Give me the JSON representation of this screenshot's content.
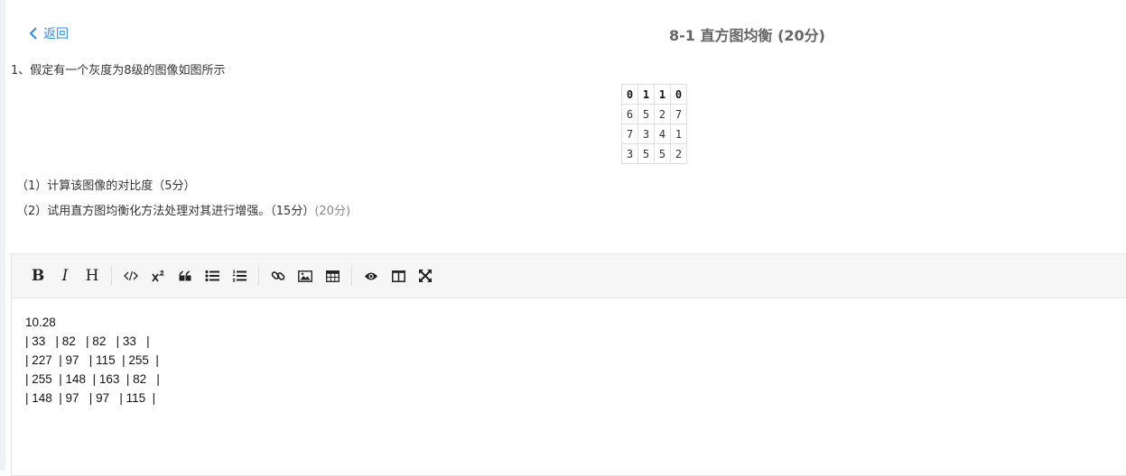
{
  "nav": {
    "back_label": "返回"
  },
  "header": {
    "title": "8-1 直方图均衡 (20分)"
  },
  "question": {
    "intro": "1、假定有一个灰度为8级的图像如图所示",
    "grid": {
      "header": [
        "0",
        "1",
        "1",
        "0"
      ],
      "rows": [
        [
          "6",
          "5",
          "2",
          "7"
        ],
        [
          "7",
          "3",
          "4",
          "1"
        ],
        [
          "3",
          "5",
          "5",
          "2"
        ]
      ]
    },
    "sub1": "（1）计算该图像的对比度（5分）",
    "sub2": "（2）试用直方图均衡化方法处理对其进行增强。（15分）",
    "sub2_score": "(20分)"
  },
  "editor": {
    "toolbar": [
      {
        "name": "bold-button",
        "label": "B"
      },
      {
        "name": "italic-button",
        "label": "I"
      },
      {
        "name": "heading-button",
        "label": "H"
      },
      {
        "name": "code-button",
        "icon": "code-icon"
      },
      {
        "name": "superscript-button",
        "icon": "superscript-icon"
      },
      {
        "name": "quote-button",
        "icon": "quote-icon"
      },
      {
        "name": "bullet-list-button",
        "icon": "bullet-list-icon"
      },
      {
        "name": "ordered-list-button",
        "icon": "ordered-list-icon"
      },
      {
        "name": "link-button",
        "icon": "link-icon"
      },
      {
        "name": "image-button",
        "icon": "image-icon"
      },
      {
        "name": "table-button",
        "icon": "table-icon"
      },
      {
        "name": "preview-button",
        "icon": "eye-icon"
      },
      {
        "name": "side-by-side-button",
        "icon": "columns-icon"
      },
      {
        "name": "fullscreen-button",
        "icon": "expand-icon"
      }
    ],
    "lines": {
      "l1": "10.28",
      "l2": "| 33   | 82   | 82   | 33   |",
      "l3": "| 227  | 97   | 115  | 255  |",
      "l4": "| 255  | 148  | 163  | 82   |",
      "l5": "| 148  | 97   | 97   | 115  |"
    }
  }
}
